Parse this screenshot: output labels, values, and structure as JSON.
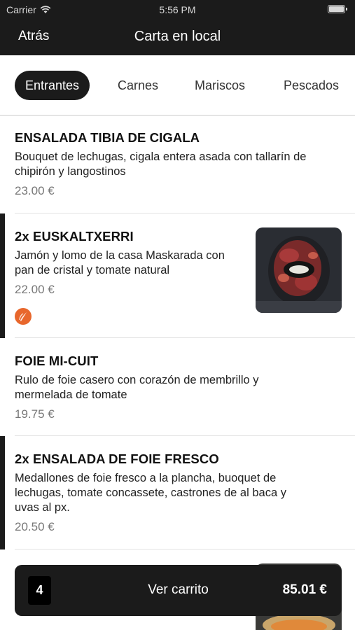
{
  "status": {
    "carrier": "Carrier",
    "time": "5:56 PM"
  },
  "nav": {
    "back_label": "Atrás",
    "title": "Carta en local"
  },
  "tabs": [
    {
      "label": "Entrantes",
      "active": true
    },
    {
      "label": "Carnes",
      "active": false
    },
    {
      "label": "Mariscos",
      "active": false
    },
    {
      "label": "Pescados",
      "active": false
    }
  ],
  "items": [
    {
      "qty": "",
      "name": "ENSALADA TIBIA DE CIGALA",
      "desc_lines": [
        "Bouquet de lechugas, cigala entera asada con tallarín de",
        "chipirón y langostinos"
      ],
      "price": "23.00 €",
      "in_cart": false
    },
    {
      "qty": "2x",
      "name": "EUSKALTXERRI",
      "desc_lines": [
        "Jamón y lomo de la casa Maskarada con",
        "pan de cristal y tomate natural"
      ],
      "price": "22.00 €",
      "in_cart": true,
      "has_image": true,
      "badge_icon": "flame-badge-icon"
    },
    {
      "qty": "",
      "name": "FOIE MI-CUIT",
      "desc_lines": [
        "Rulo de foie casero con corazón de membrillo y",
        "mermelada de tomate"
      ],
      "price": "19.75 €",
      "in_cart": false
    },
    {
      "qty": "2x",
      "name": "ENSALADA DE FOIE FRESCO",
      "desc_lines": [
        "Medallones de foie fresco a la plancha, buoquet de",
        "lechugas, tomate concassete, castrones de al baca y",
        "uvas al px."
      ],
      "price": "20.50 €",
      "in_cart": true
    }
  ],
  "cart": {
    "count": "4",
    "label": "Ver carrito",
    "total": "85.01 €"
  },
  "colors": {
    "dark": "#1b1b1b",
    "badge": "#e8672c",
    "price": "#777777"
  }
}
